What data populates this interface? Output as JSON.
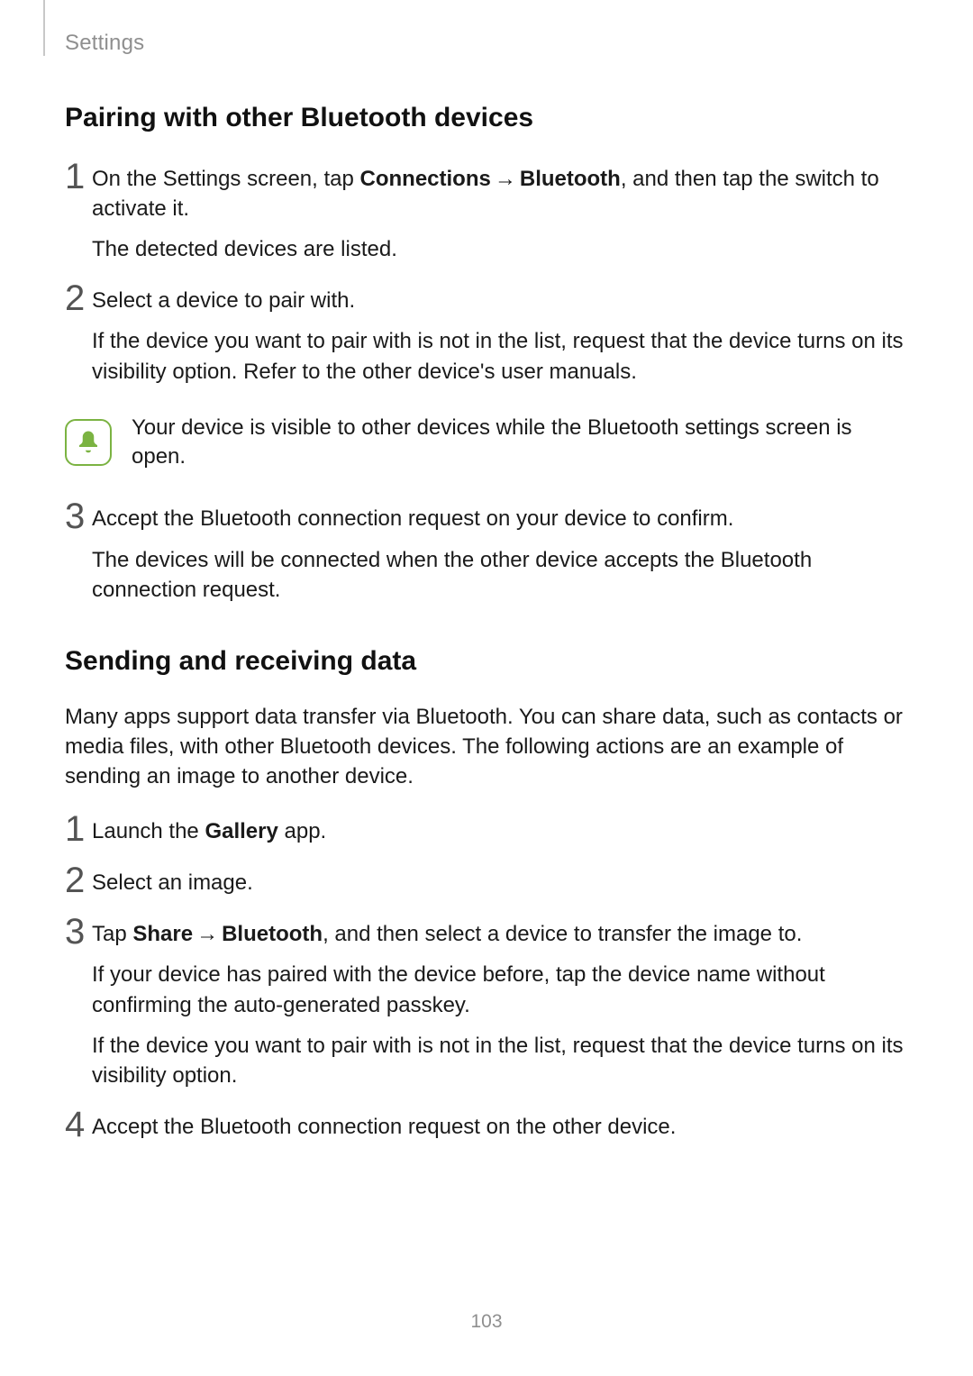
{
  "header": {
    "section": "Settings"
  },
  "sectionA": {
    "title": "Pairing with other Bluetooth devices",
    "steps": [
      {
        "num": "1",
        "p1_a": "On the Settings screen, tap ",
        "p1_b": "Connections",
        "p1_arrow": "→",
        "p1_c": "Bluetooth",
        "p1_d": ", and then tap the switch to activate it.",
        "p2": "The detected devices are listed."
      },
      {
        "num": "2",
        "p1": "Select a device to pair with.",
        "p2": "If the device you want to pair with is not in the list, request that the device turns on its visibility option. Refer to the other device's user manuals."
      },
      {
        "num": "3",
        "p1": "Accept the Bluetooth connection request on your device to confirm.",
        "p2": "The devices will be connected when the other device accepts the Bluetooth connection request."
      }
    ],
    "note": "Your device is visible to other devices while the Bluetooth settings screen is open."
  },
  "sectionB": {
    "title": "Sending and receiving data",
    "intro": "Many apps support data transfer via Bluetooth. You can share data, such as contacts or media files, with other Bluetooth devices. The following actions are an example of sending an image to another device.",
    "steps": [
      {
        "num": "1",
        "p1_a": "Launch the ",
        "p1_b": "Gallery",
        "p1_c": " app."
      },
      {
        "num": "2",
        "p1": "Select an image."
      },
      {
        "num": "3",
        "p1_a": "Tap ",
        "p1_b": "Share",
        "p1_arrow": "→",
        "p1_c": "Bluetooth",
        "p1_d": ", and then select a device to transfer the image to.",
        "p2": "If your device has paired with the device before, tap the device name without confirming the auto-generated passkey.",
        "p3": "If the device you want to pair with is not in the list, request that the device turns on its visibility option."
      },
      {
        "num": "4",
        "p1": "Accept the Bluetooth connection request on the other device."
      }
    ]
  },
  "page_number": "103"
}
